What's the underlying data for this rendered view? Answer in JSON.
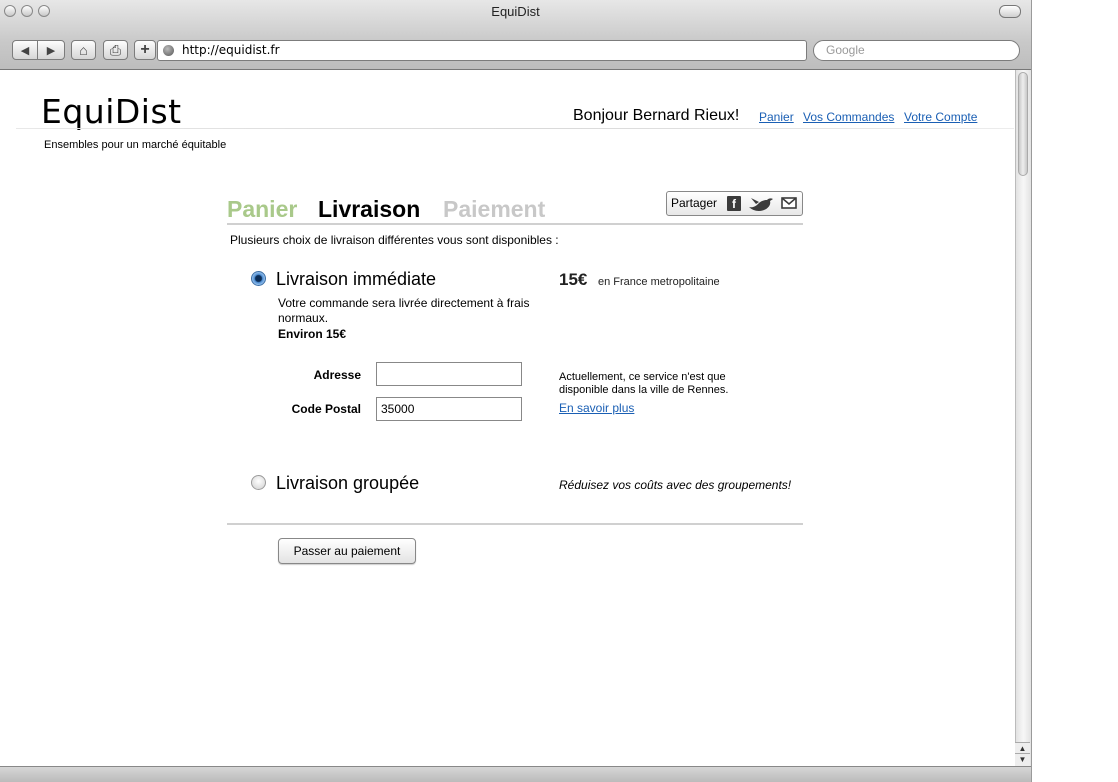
{
  "browser": {
    "window_title": "EquiDist",
    "url": "http://equidist.fr",
    "search_placeholder": "Google",
    "nav": {
      "back": "◀",
      "forward": "▶",
      "home": "⌂",
      "print": "⎙",
      "add": "+"
    },
    "scroll": {
      "up": "▲",
      "down": "▼"
    }
  },
  "site": {
    "logo": "EquiDist",
    "tagline": "Ensembles pour un marché équitable",
    "greeting": "Bonjour Bernard Rieux!",
    "links": [
      "Panier",
      "Vos Commandes",
      "Votre Compte"
    ],
    "link_color": "#1a5fb4"
  },
  "steps": [
    {
      "label": "Panier",
      "state": "done",
      "color": "#a9c98a"
    },
    {
      "label": "Livraison",
      "state": "current",
      "color": "#000000"
    },
    {
      "label": "Paiement",
      "state": "upcoming",
      "color": "#c8c8c8"
    }
  ],
  "share": {
    "label": "Partager",
    "icons": [
      "facebook-icon",
      "twitter-bird-icon",
      "mail-icon"
    ],
    "facebook_glyph": "f"
  },
  "delivery": {
    "intro": "Plusieurs choix de livraison différentes vous sont disponibles :",
    "option_immediate": {
      "title": "Livraison immédiate",
      "selected": true,
      "description": "Votre commande sera livrée directement à frais normaux.",
      "approx": "Environ 15€",
      "price": "15€",
      "price_note": "en France metropolitaine",
      "address_label": "Adresse",
      "address_value": "",
      "postal_label": "Code Postal",
      "postal_value": "35000",
      "notice": "Actuellement, ce service n'est que disponible dans la ville de Rennes.",
      "learn_more": "En savoir plus"
    },
    "option_grouped": {
      "title": "Livraison groupée",
      "selected": false,
      "promo": "Réduisez vos coûts avec des groupements!"
    }
  },
  "actions": {
    "pay_button": "Passer au paiement"
  }
}
